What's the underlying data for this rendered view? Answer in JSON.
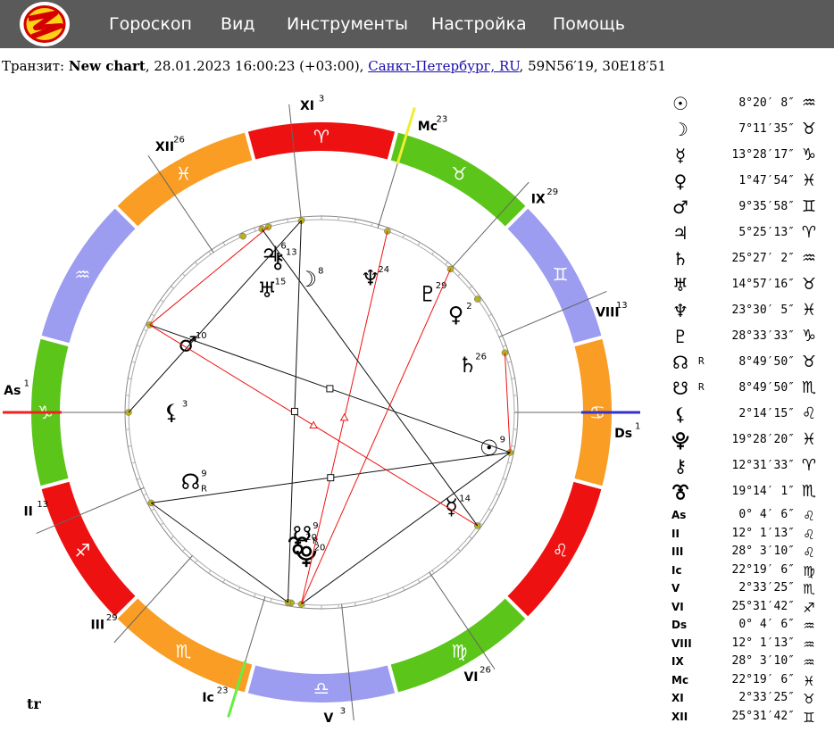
{
  "menu": {
    "logo_icon": "app-logo-icon",
    "items": [
      "Гороскоп",
      "Вид",
      "Инструменты",
      "Настройка",
      "Помощь"
    ]
  },
  "info": {
    "prefix": "Транзит:",
    "chart_name": "New chart",
    "datetime": ", 28.01.2023 16:00:23 (+03:00),",
    "location": "Санкт-Петербург, RU",
    "coords": ", 59N56′19, 30E18′51"
  },
  "chart": {
    "label": "tr",
    "sign_order": [
      "♈",
      "♉",
      "♊",
      "♋",
      "♌",
      "♍",
      "♎",
      "♏",
      "♐",
      "♑",
      "♒",
      "♓"
    ],
    "element_colors": {
      "fire": "#ee1111",
      "earth": "#f99d25",
      "air": "#9c9cf0",
      "water": "#5cc51a"
    },
    "axis_colors": {
      "asc": "#ee2222",
      "dsc": "#3333cc",
      "mc": "#eeee33",
      "ic": "#66ee44"
    },
    "cusps": [
      {
        "label": "As",
        "deg": "1"
      },
      {
        "label": "II",
        "deg": "13"
      },
      {
        "label": "III",
        "deg": "29"
      },
      {
        "label": "Ic",
        "deg": "23"
      },
      {
        "label": "V",
        "deg": "3"
      },
      {
        "label": "VI",
        "deg": "26"
      },
      {
        "label": "Ds",
        "deg": "1"
      },
      {
        "label": "VIII",
        "deg": "13"
      },
      {
        "label": "IX",
        "deg": "29"
      },
      {
        "label": "Mc",
        "deg": "23"
      },
      {
        "label": "XI",
        "deg": "3"
      },
      {
        "label": "XII",
        "deg": "26"
      }
    ],
    "planet_labels": [
      {
        "glyph": "☉",
        "deg": "9"
      },
      {
        "glyph": "☽",
        "deg": "8"
      },
      {
        "glyph": "☿",
        "deg": "14"
      },
      {
        "glyph": "♀",
        "deg": "2"
      },
      {
        "glyph": "♂",
        "deg": "10"
      },
      {
        "glyph": "♃",
        "deg": "6"
      },
      {
        "glyph": "♄",
        "deg": "26"
      },
      {
        "glyph": "♅",
        "deg": "15"
      },
      {
        "glyph": "♆",
        "deg": "24"
      },
      {
        "glyph": "♇",
        "deg": "29"
      },
      {
        "glyph": "☊",
        "deg": "9",
        "retro": "R"
      },
      {
        "glyph": "☋",
        "deg": "9",
        "retro": "R"
      },
      {
        "glyph": "⚸",
        "deg": "3"
      },
      {
        "glyph": "⯓",
        "deg": "20"
      },
      {
        "glyph": "⚷",
        "deg": "13"
      },
      {
        "glyph": "⯔",
        "deg": "20"
      }
    ]
  },
  "positions": [
    {
      "glyph": "☉",
      "retro": "",
      "pos": "8°20′ 8″",
      "sign": "♒"
    },
    {
      "glyph": "☽",
      "retro": "",
      "pos": "7°11′35″",
      "sign": "♉"
    },
    {
      "glyph": "☿",
      "retro": "",
      "pos": "13°28′17″",
      "sign": "♑"
    },
    {
      "glyph": "♀",
      "retro": "",
      "pos": "1°47′54″",
      "sign": "♓"
    },
    {
      "glyph": "♂",
      "retro": "",
      "pos": "9°35′58″",
      "sign": "♊"
    },
    {
      "glyph": "♃",
      "retro": "",
      "pos": "5°25′13″",
      "sign": "♈"
    },
    {
      "glyph": "♄",
      "retro": "",
      "pos": "25°27′ 2″",
      "sign": "♒"
    },
    {
      "glyph": "♅",
      "retro": "",
      "pos": "14°57′16″",
      "sign": "♉"
    },
    {
      "glyph": "♆",
      "retro": "",
      "pos": "23°30′ 5″",
      "sign": "♓"
    },
    {
      "glyph": "♇",
      "retro": "",
      "pos": "28°33′33″",
      "sign": "♑"
    },
    {
      "glyph": "☊",
      "retro": "R",
      "pos": "8°49′50″",
      "sign": "♉"
    },
    {
      "glyph": "☋",
      "retro": "R",
      "pos": "8°49′50″",
      "sign": "♏"
    },
    {
      "glyph": "⚸",
      "retro": "",
      "pos": "2°14′15″",
      "sign": "♌"
    },
    {
      "glyph": "⯓",
      "retro": "",
      "pos": "19°28′20″",
      "sign": "♓"
    },
    {
      "glyph": "⚷",
      "retro": "",
      "pos": "12°31′33″",
      "sign": "♈"
    },
    {
      "glyph": "⯔",
      "retro": "",
      "pos": "19°14′ 1″",
      "sign": "♏"
    },
    {
      "glyph": "As",
      "retro": "",
      "pos": "0° 4′ 6″",
      "sign": "♌",
      "small": true
    },
    {
      "glyph": "II",
      "retro": "",
      "pos": "12° 1′13″",
      "sign": "♌",
      "small": true
    },
    {
      "glyph": "III",
      "retro": "",
      "pos": "28° 3′10″",
      "sign": "♌",
      "small": true
    },
    {
      "glyph": "Ic",
      "retro": "",
      "pos": "22°19′ 6″",
      "sign": "♍",
      "small": true
    },
    {
      "glyph": "V",
      "retro": "",
      "pos": "2°33′25″",
      "sign": "♏",
      "small": true
    },
    {
      "glyph": "VI",
      "retro": "",
      "pos": "25°31′42″",
      "sign": "♐",
      "small": true
    },
    {
      "glyph": "Ds",
      "retro": "",
      "pos": "0° 4′ 6″",
      "sign": "♒",
      "small": true
    },
    {
      "glyph": "VIII",
      "retro": "",
      "pos": "12° 1′13″",
      "sign": "♒",
      "small": true
    },
    {
      "glyph": "IX",
      "retro": "",
      "pos": "28° 3′10″",
      "sign": "♒",
      "small": true
    },
    {
      "glyph": "Mc",
      "retro": "",
      "pos": "22°19′ 6″",
      "sign": "♓",
      "small": true
    },
    {
      "glyph": "XI",
      "retro": "",
      "pos": "2°33′25″",
      "sign": "♉",
      "small": true
    },
    {
      "glyph": "XII",
      "retro": "",
      "pos": "25°31′42″",
      "sign": "♊",
      "small": true
    }
  ]
}
